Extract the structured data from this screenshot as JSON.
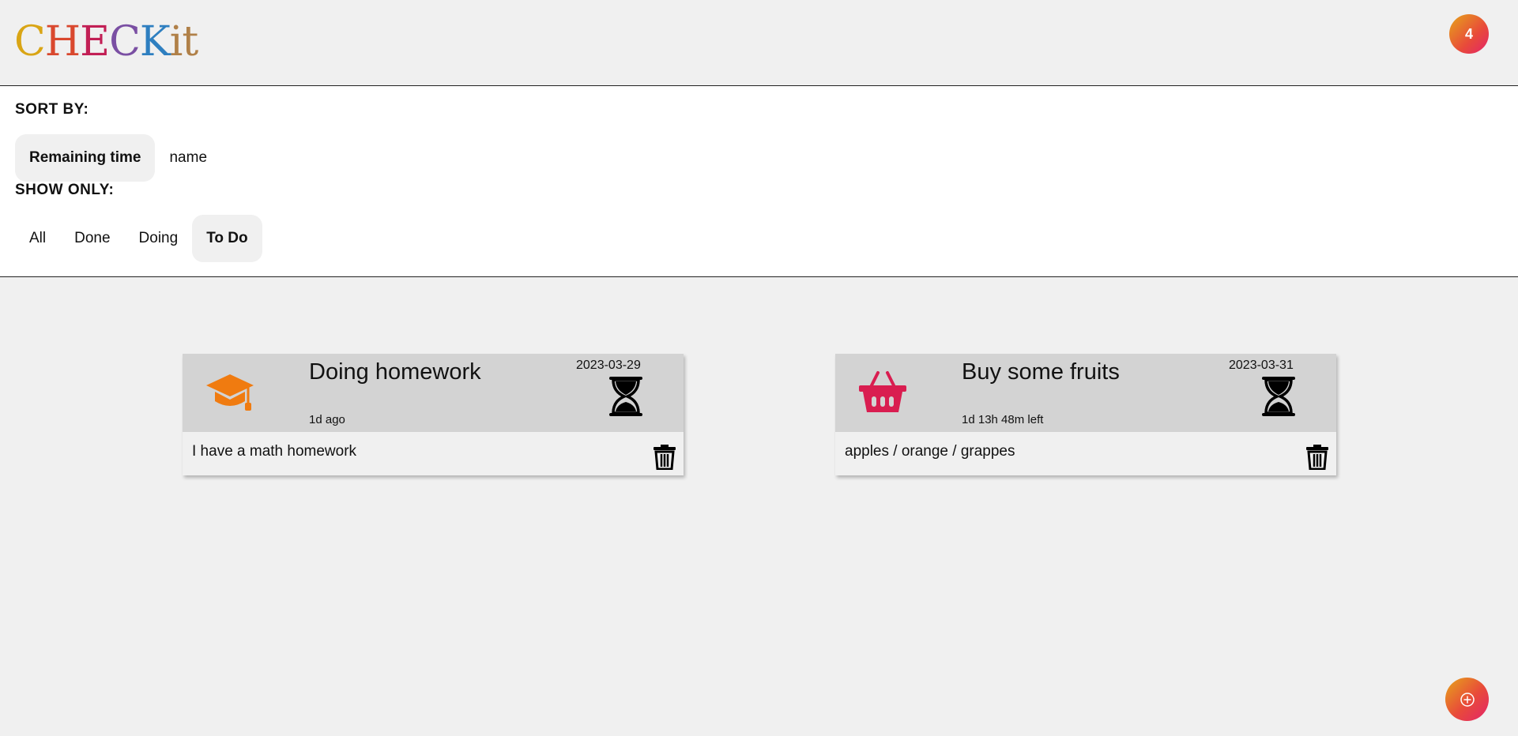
{
  "header": {
    "logo": [
      "C",
      "H",
      "E",
      "C",
      "K",
      "it"
    ],
    "logo_colors": [
      "#d9a515",
      "#d9482e",
      "#c21f55",
      "#7a4fa3",
      "#2e7fc0",
      "#b08048"
    ],
    "counter": "4"
  },
  "filters": {
    "sort_label": "SORT BY:",
    "sort_options": [
      {
        "label": "Remaining time",
        "active": true
      },
      {
        "label": "name",
        "active": false
      }
    ],
    "show_label": "SHOW ONLY:",
    "show_options": [
      {
        "label": "All",
        "active": false
      },
      {
        "label": "Done",
        "active": false
      },
      {
        "label": "Doing",
        "active": false
      },
      {
        "label": "To Do",
        "active": true
      }
    ]
  },
  "tasks": [
    {
      "icon": "graduation-cap-icon",
      "icon_color": "#f07b10",
      "title": "Doing homework",
      "status": "1d ago",
      "date": "2023-03-29",
      "description": "I have a math homework"
    },
    {
      "icon": "basket-icon",
      "icon_color": "#d91d50",
      "title": "Buy some fruits",
      "status": "1d 13h 48m left",
      "date": "2023-03-31",
      "description": "apples / orange / grappes"
    }
  ],
  "colors": {
    "accent_gradient_start": "#e6a51a",
    "accent_gradient_end": "#e3246b",
    "card_header": "#d3d3d3"
  },
  "fab_icon": "add-circle-icon"
}
